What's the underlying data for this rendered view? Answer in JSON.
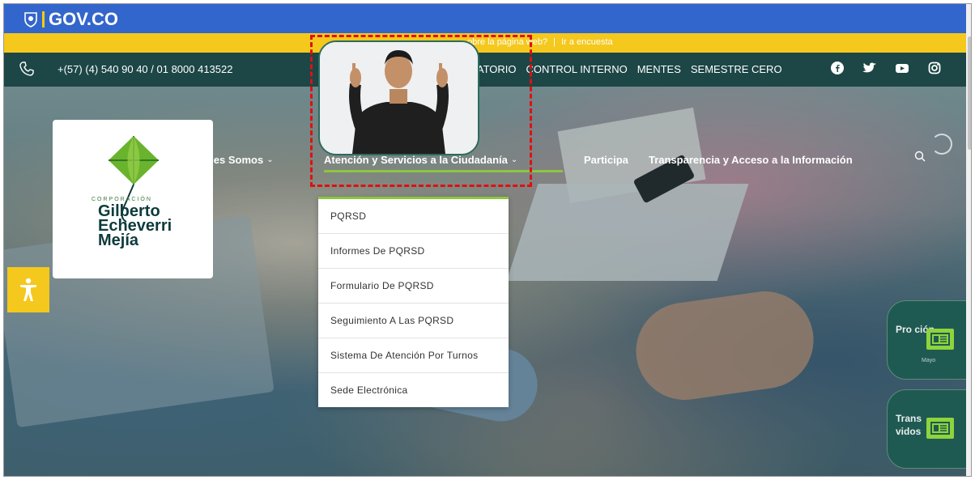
{
  "gov": {
    "brand": "GOV.CO"
  },
  "survey": {
    "text": "obre la página web?",
    "link": "Ir a encuesta"
  },
  "contact": {
    "phone": "+(57) (4) 540 90 40 / 01 8000 413522"
  },
  "topnav": {
    "items": [
      "RVATORIO",
      "CONTROL INTERNO",
      "MENTES",
      "SEMESTRE CERO"
    ]
  },
  "social": [
    "facebook-icon",
    "twitter-icon",
    "youtube-icon",
    "instagram-icon"
  ],
  "logo": {
    "corp": "CORPORACIÓN",
    "name_line1": "Gilberto",
    "name_line2": "Echeverri",
    "name_line3": "Mejía"
  },
  "mainnav": {
    "quienes": "iénes Somos",
    "atencion": "Atención y Servicios a la Ciudadanía",
    "participa": "Participa",
    "transparencia": "Transparencia y Acceso a la Información"
  },
  "dropdown": {
    "items": [
      "PQRSD",
      "Informes De PQRSD",
      "Formulario De PQRSD",
      "Seguimiento A Las PQRSD",
      "Sistema De Atención Por Turnos",
      "Sede Electrónica"
    ]
  },
  "cards": [
    {
      "title": "Pro   ción",
      "sub": "Mayo"
    },
    {
      "title": "Trans",
      "title2": "vidos"
    }
  ],
  "colors": {
    "gov_blue": "#3366cc",
    "yellow": "#f4c81d",
    "dark_teal": "#1d4646",
    "accent_green": "#8dc63f",
    "highlight_red": "#e01010"
  }
}
